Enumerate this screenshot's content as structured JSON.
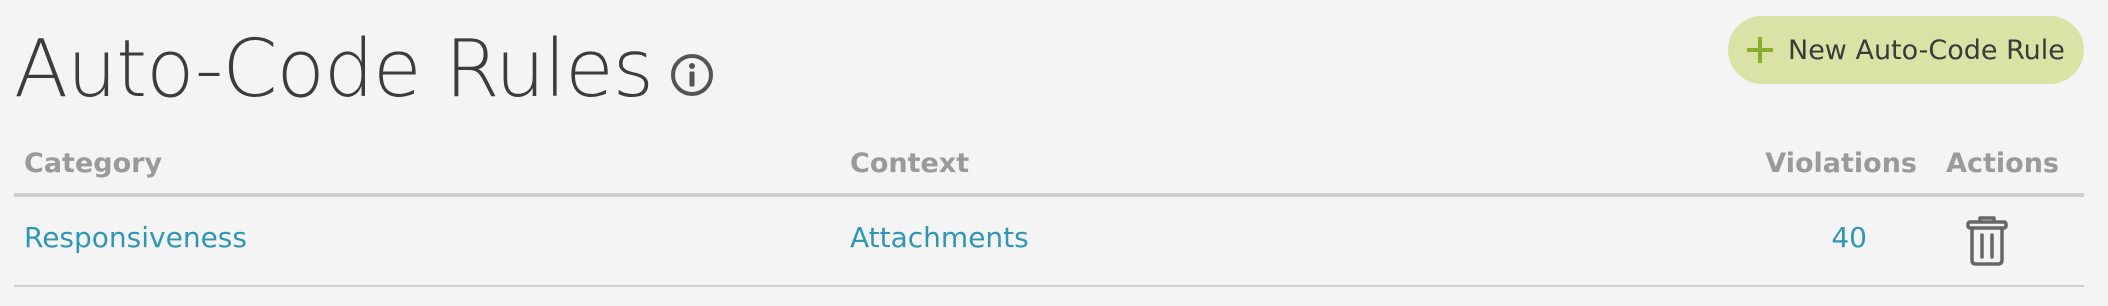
{
  "header": {
    "title": "Auto-Code Rules",
    "info_icon": "info-circle-icon",
    "new_rule_button": {
      "label": "New Auto-Code Rule",
      "icon": "plus-icon",
      "background": "#d8e3a5",
      "icon_color": "#8aad2b"
    }
  },
  "table": {
    "columns": {
      "category": "Category",
      "context": "Context",
      "violations": "Violations",
      "actions": "Actions"
    },
    "rows": [
      {
        "category": "Responsiveness",
        "context": "Attachments",
        "violations": "40",
        "action_icon": "trash-icon"
      }
    ],
    "link_color": "#2f96b4"
  }
}
